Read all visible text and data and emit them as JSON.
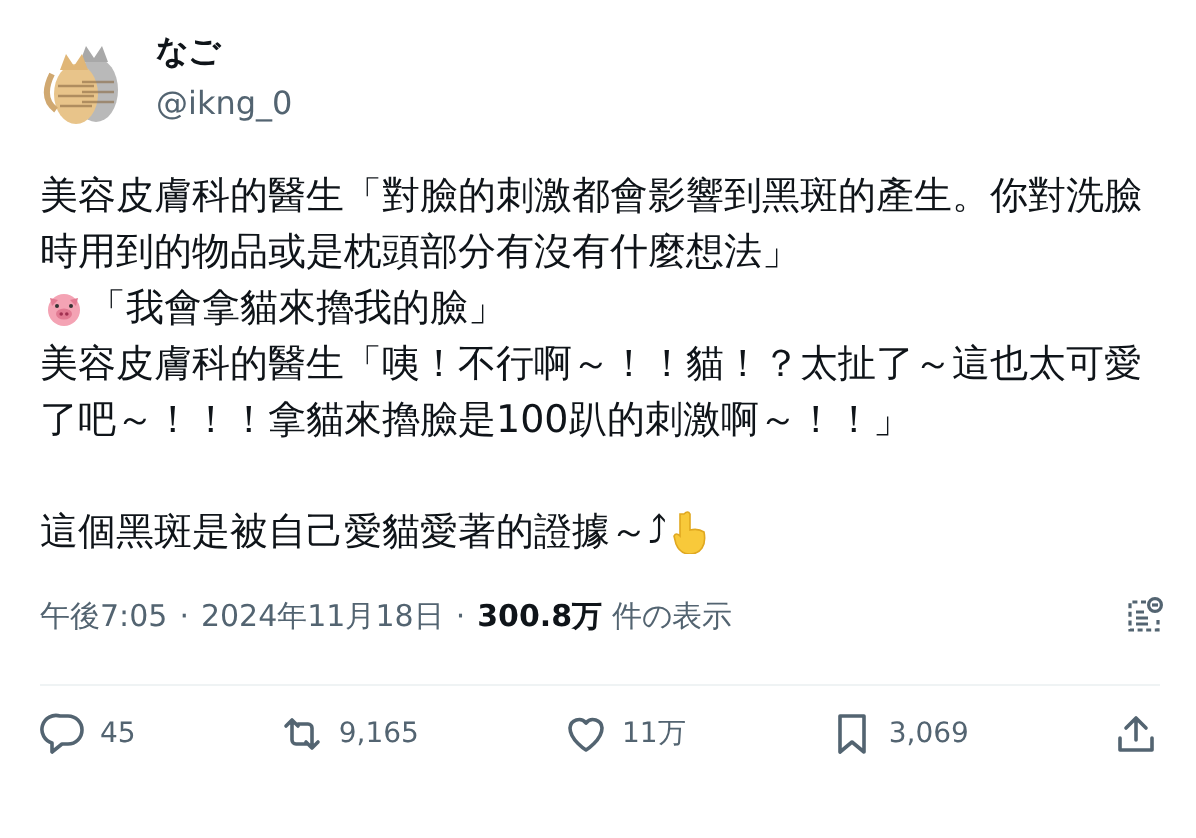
{
  "author": {
    "name": "なご",
    "handle": "@ikng_0"
  },
  "body": [
    {
      "kind": "text",
      "text": "美容皮膚科的醫生「對臉的刺激都會影響到黑斑的產生。你對洗臉時用到的物品或是枕頭部分有沒有什麼想法」"
    },
    {
      "kind": "pig",
      "text": "「我會拿貓來擼我的臉」"
    },
    {
      "kind": "text",
      "text": "美容皮膚科的醫生「咦！不行啊～！！貓！？太扯了～這也太可愛了吧～！！！拿貓來擼臉是100趴的刺激啊～！！」"
    },
    {
      "kind": "gap"
    },
    {
      "kind": "point",
      "text": "這個黑斑是被自己愛貓愛著的證據～⤴"
    }
  ],
  "meta": {
    "time": "午後7:05",
    "separator_1": "·",
    "date": "2024年11月18日",
    "separator_2": "·",
    "views": "**300.8万** 件の表示"
  },
  "actions": [
    {
      "kind": "reply",
      "count": "45"
    },
    {
      "kind": "repost",
      "count": "9,165"
    },
    {
      "kind": "like",
      "count": "11万"
    },
    {
      "kind": "bookmark",
      "count": "3,069"
    },
    {
      "kind": "share"
    }
  ]
}
